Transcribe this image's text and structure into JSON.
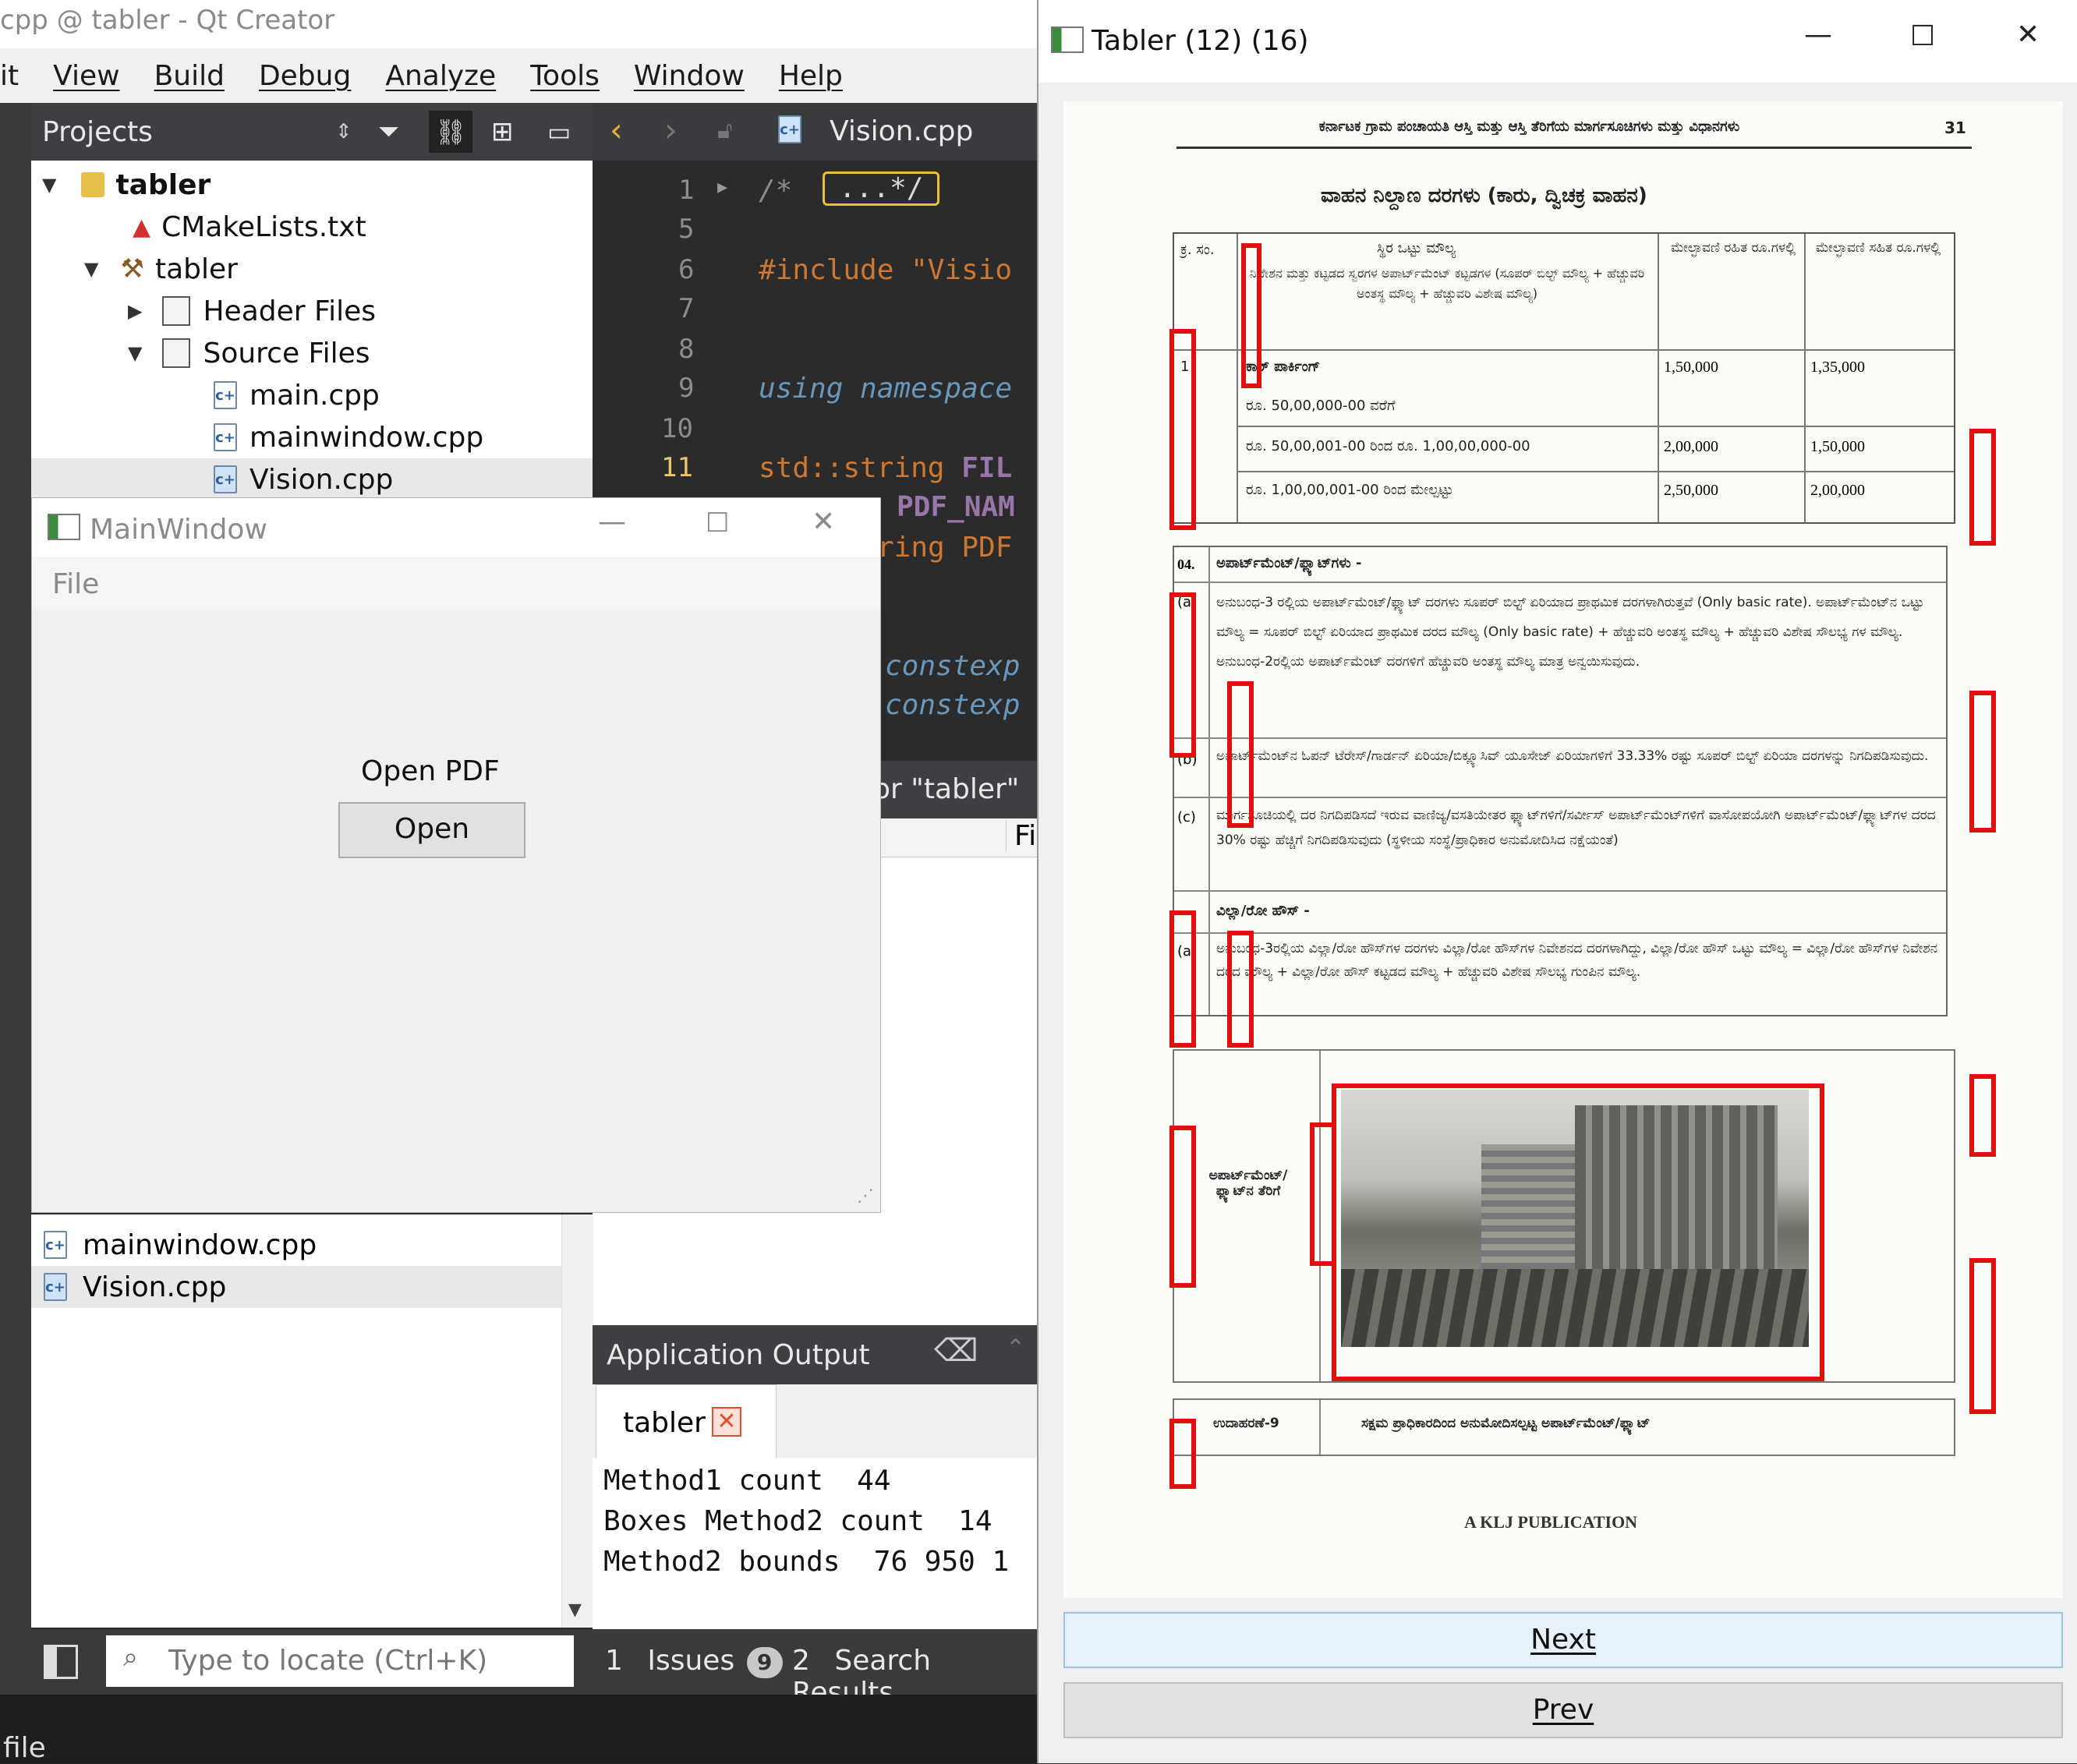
{
  "qtcreator": {
    "window_title": "cpp @ tabler - Qt Creator",
    "menu": [
      "it",
      "View",
      "Build",
      "Debug",
      "Analyze",
      "Tools",
      "Window",
      "Help"
    ],
    "projects_label": "Projects",
    "tree": {
      "root": "tabler",
      "cmakelists": "CMakeLists.txt",
      "target": "tabler",
      "header_files": "Header Files",
      "source_files": "Source Files",
      "main_cpp": "main.cpp",
      "mainwindow_cpp": "mainwindow.cpp",
      "vision_cpp": "Vision.cpp"
    },
    "open_docs": {
      "mainwindow_cpp": "mainwindow.cpp",
      "vision_cpp": "Vision.cpp"
    },
    "editor_tab": "Vision.cpp",
    "line_numbers": [
      "1",
      "5",
      "6",
      "7",
      "8",
      "9",
      "10",
      "11"
    ],
    "code": {
      "l1_comment": "/*",
      "l1_fold": "...*/",
      "l6": "#include \"Visio",
      "l9": "using namespace",
      "l11_a": "std::string ",
      "l11_b": "FIL",
      "l12": "PDF_NAM",
      "l13": "ring PDF",
      "l16": "constexp",
      "l17": "constexp"
    },
    "search_header": "or \"tabler\"",
    "search_col": "Fil",
    "app_output_label": "Application Output",
    "app_output_tab": "tabler",
    "output_lines": [
      "Method1 count  44",
      "Boxes Method2 count  14",
      "Method2 bounds  76 950 1"
    ],
    "locator_placeholder": "Type to locate (Ctrl+K)",
    "status": {
      "issues_num": "1",
      "issues_label": "Issues",
      "issues_badge": "9",
      "search_num": "2",
      "search_label": "Search Results"
    },
    "bottom_text": "file"
  },
  "main_window": {
    "title": "MainWindow",
    "menu_file": "File",
    "open_label": "Open PDF",
    "open_button": "Open"
  },
  "tabler": {
    "title": "Tabler (12) (16)",
    "next_button": "Next",
    "prev_button": "Prev",
    "document": {
      "page_number": "31",
      "header": "ಕರ್ನಾಟಕ ಗ್ರಾಮ ಪಂಚಾಯತಿ ಆಸ್ತಿ ಮತ್ತು ಆಸ್ತಿ ತೆರಿಗೆಯ ಮಾರ್ಗಸೂಚಿಗಳು ಮತ್ತು ವಿಧಾನಗಳು",
      "heading": "ವಾಹನ ನಿಲ್ದಾಣ ದರಗಳು (ಕಾರು, ದ್ವಿಚಕ್ರ ವಾಹನ)",
      "col_sno": "ಕ್ರ. ಸಂ.",
      "col_a": "ಸ್ಥಿರ ಒಟ್ಟು ಮೌಲ್ಯ",
      "col_b": "ಮೇಲ್ಛಾವಣಿ ರಹಿತ ರೂ.ಗಳಲ್ಲಿ",
      "col_c": "ಮೇಲ್ಛಾವಣಿ ಸಹಿತ ರೂ.ಗಳಲ್ಲಿ",
      "col_a_note": "ನಿವೇಶನ ಮತ್ತು ಕಟ್ಟಡದ ಸ್ವರಗಳ ಅಪಾರ್ಟ್‌ಮೆಂಟ್ ಕಟ್ಟಡಗಳ (ಸೂಪರ್ ಬಿಲ್ಟ್ ಮೌಲ್ಯ + ಹೆಚ್ಚುವರಿ ಅಂತಸ್ಥ ಮೌಲ್ಯ + ಹೆಚ್ಚುವರಿ ವಿಶೇಷ ಮೌಲ್ಯ)",
      "row1_no": "1",
      "row1_label": "ಕಾರ್ ಪಾರ್ಕಿಂಗ್",
      "row1_sub": "ರೂ. 50,00,000-00 ವರೆಗೆ",
      "row1_b": "1,50,000",
      "row1_c": "1,35,000",
      "row2_label": "ರೂ. 50,00,001-00 ರಿಂದ ರೂ. 1,00,00,000-00",
      "row2_b": "2,00,000",
      "row2_c": "1,50,000",
      "row3_label": "ರೂ. 1,00,00,001-00 ರಿಂದ ಮೇಲ್ಪಟ್ಟು",
      "row3_b": "2,50,000",
      "row3_c": "2,00,000",
      "sec04_no": "04.",
      "sec04_title": "ಅಪಾರ್ಟ್‌ಮೆಂಟ್/ಫ್ಲ್ಯಾಟ್‌ಗಳು -",
      "a_no": "(a)",
      "a_text": "ಅನುಬಂಧ-3 ರಲ್ಲಿಯ ಅಪಾರ್ಟ್‌ಮೆಂಟ್/ಫ್ಲ್ಯಾಟ್ ದರಗಳು ಸೂಪರ್ ಬಿಲ್ಟ್ ಏರಿಯಾದ ಪ್ರಾಥಮಿಕ ದರಗಳಾಗಿರುತ್ತವೆ (Only basic rate). ಅಪಾರ್ಟ್‌ಮೆಂಟ್‌ನ ಒಟ್ಟು ಮೌಲ್ಯ = ಸೂಪರ್ ಬಿಲ್ಟ್ ಏರಿಯಾದ ಪ್ರಾಥಮಿಕ ದರದ ಮೌಲ್ಯ (Only basic rate) + ಹೆಚ್ಚುವರಿ ಅಂತಸ್ಥ ಮೌಲ್ಯ + ಹೆಚ್ಚುವರಿ ವಿಶೇಷ ಸೌಲಭ್ಯ ಗಳ ಮೌಲ್ಯ. ಅನುಬಂಧ-2ರಲ್ಲಿಯ ಅಪಾರ್ಟ್‌ಮೆಂಟ್ ದರಗಳಿಗೆ ಹೆಚ್ಚುವರಿ ಅಂತಸ್ಥ ಮೌಲ್ಯ ಮಾತ್ರ ಅನ್ವಯಿಸುವುದು.",
      "b_no": "(b)",
      "b_text": "ಅಪಾರ್ಟ್‌ಮೆಂಟ್‌ನ ಓಪನ್ ಟೆರೇಸ್/ಗಾರ್ಡನ್ ಏರಿಯಾ/ಬಿಕ್ಲ್ಯೂಸಿವ್ ಯೂಸೇಜ್ ಏರಿಯಾಗಳಿಗೆ 33.33% ರಷ್ಟು ಸೂಪರ್ ಬಿಲ್ಟ್ ಏರಿಯಾ ದರಗಳನ್ನು ನಿಗದಿಪಡಿಸುವುದು.",
      "c_no": "(c)",
      "c_text": "ಮಾರ್ಗಸೂಚಿಯಲ್ಲಿ ದರ ನಿಗದಿಪಡಿಸದೆ ಇರುವ ವಾಣಿಜ್ಯ/ವಸತಿಯೇತರ ಫ್ಲ್ಯಾಟ್‌ಗಳಿಗೆ/ಸರ್ವೀಸ್ ಅಪಾರ್ಟ್‌ಮೆಂಟ್‌ಗಳಿಗೆ ವಾಸೋಪಯೋಗಿ ಅಪಾರ್ಟ್‌ಮೆಂಟ್/ಫ್ಲ್ಯಾಟ್‌ಗಳ ದರದ 30% ರಷ್ಟು ಹೆಚ್ಚಿಗೆ ನಿಗದಿಪಡಿಸುವುದು (ಸ್ಥಳೀಯ ಸಂಸ್ಥೆ/ಪ್ರಾಧಿಕಾರ ಅನುಮೋದಿಸಿದ ನಕ್ಷೆಯಂತೆ)",
      "villa_title": "ವಿಲ್ಲಾ/ರೋ ಹೌಸ್ -",
      "va_no": "(a)",
      "va_text": "ಅನುಬಂಧ-3ರಲ್ಲಿಯ ವಿಲ್ಲಾ/ರೋ ಹೌಸ್‌ಗಳ ದರಗಳು ವಿಲ್ಲಾ/ರೋ ಹೌಸ್‌ಗಳ ನಿವೇಶನದ ದರಗಳಾಗಿದ್ದು, ವಿಲ್ಲಾ/ರೋ ಹೌಸ್ ಒಟ್ಟು ಮೌಲ್ಯ = ವಿಲ್ಲಾ/ರೋ ಹೌಸ್‌ಗಳ ನಿವೇಶನ ದರದ ಮೌಲ್ಯ + ವಿಲ್ಲಾ/ರೋ ಹೌಸ್ ಕಟ್ಟಡದ ಮೌಲ್ಯ + ಹೆಚ್ಚುವರಿ ವಿಶೇಷ ಸೌಲಭ್ಯ ಗುಂಪಿನ ಮೌಲ್ಯ.",
      "photo_label": "ಅಪಾರ್ಟ್‌ಮೆಂಟ್/ ಫ್ಲ್ಯಾಟ್‌ನ ತೆರಿಗೆ",
      "example_label": "ಉದಾಹರಣೆ-9",
      "example_text": "ಸಕ್ಷಮ ಪ್ರಾಧಿಕಾರದಿಂದ ಅನುಮೋದಿಸಲ್ಪಟ್ಟ ಅಪಾರ್ಟ್‌ಮೆಂಟ್/ಫ್ಲ್ಯಾಟ್",
      "footer": "A KLJ PUBLICATION"
    }
  },
  "colors": {
    "accent_red": "#e01010",
    "editor_bg": "#2b2b2b",
    "keyword_orange": "#cc7832",
    "italic_blue": "#6897bb"
  }
}
